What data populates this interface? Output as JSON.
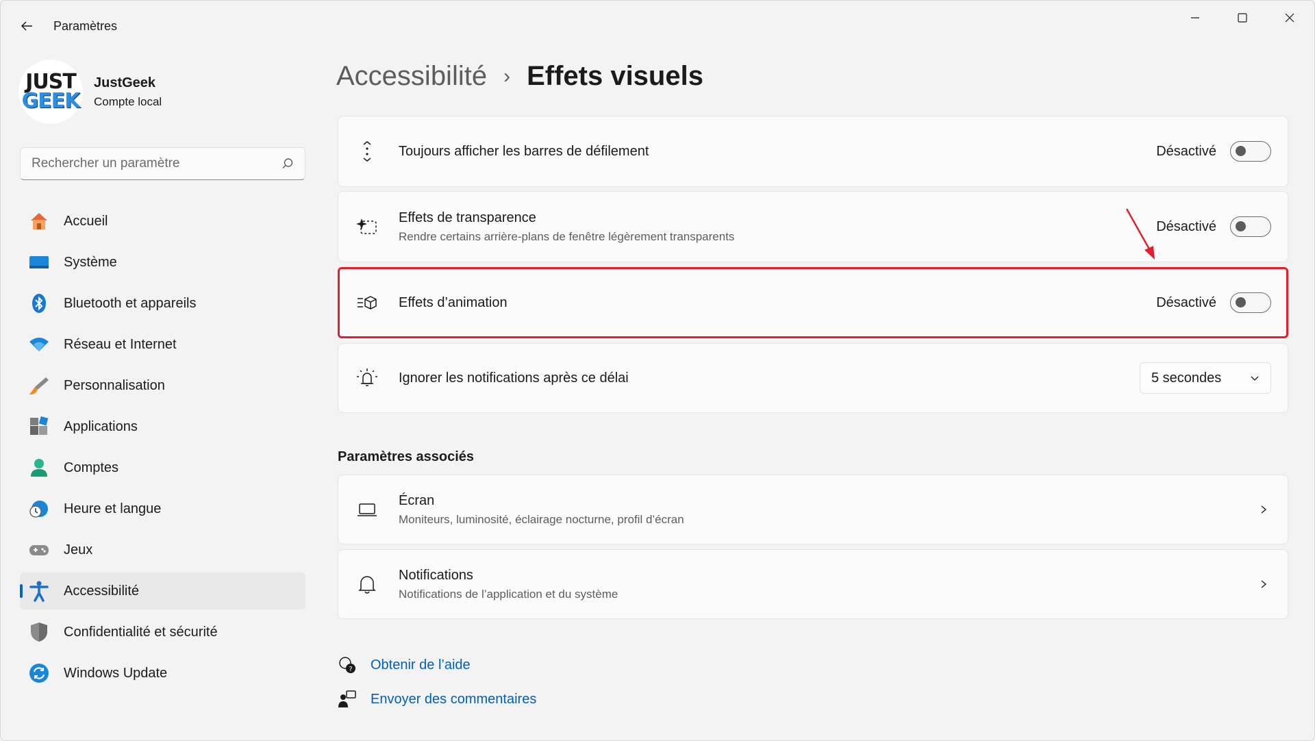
{
  "window": {
    "title": "Paramètres"
  },
  "profile": {
    "logo_line1": "JUST",
    "logo_line2": "GEEK",
    "name": "JustGeek",
    "account_type": "Compte local"
  },
  "search": {
    "placeholder": "Rechercher un paramètre"
  },
  "sidebar": {
    "items": [
      {
        "label": "Accueil",
        "icon": "home-icon"
      },
      {
        "label": "Système",
        "icon": "system-icon"
      },
      {
        "label": "Bluetooth et appareils",
        "icon": "bluetooth-icon"
      },
      {
        "label": "Réseau et Internet",
        "icon": "wifi-icon"
      },
      {
        "label": "Personnalisation",
        "icon": "brush-icon"
      },
      {
        "label": "Applications",
        "icon": "apps-icon"
      },
      {
        "label": "Comptes",
        "icon": "account-icon"
      },
      {
        "label": "Heure et langue",
        "icon": "clock-globe-icon"
      },
      {
        "label": "Jeux",
        "icon": "gamepad-icon"
      },
      {
        "label": "Accessibilité",
        "icon": "accessibility-icon",
        "active": true
      },
      {
        "label": "Confidentialité et sécurité",
        "icon": "shield-icon"
      },
      {
        "label": "Windows Update",
        "icon": "update-icon"
      }
    ]
  },
  "breadcrumb": {
    "parent": "Accessibilité",
    "separator": "›",
    "current": "Effets visuels"
  },
  "settings": [
    {
      "title": "Toujours afficher les barres de défilement",
      "state": "Désactivé",
      "on": false
    },
    {
      "title": "Effets de transparence",
      "subtitle": "Rendre certains arrière-plans de fenêtre légèrement transparents",
      "state": "Désactivé",
      "on": false
    },
    {
      "title": "Effets d’animation",
      "state": "Désactivé",
      "on": false,
      "highlighted": true
    },
    {
      "title": "Ignorer les notifications après ce délai",
      "dropdown_value": "5 secondes"
    }
  ],
  "related": {
    "heading": "Paramètres associés",
    "items": [
      {
        "title": "Écran",
        "subtitle": "Moniteurs, luminosité, éclairage nocturne, profil d’écran"
      },
      {
        "title": "Notifications",
        "subtitle": "Notifications de l’application et du système"
      }
    ]
  },
  "links": {
    "help": "Obtenir de l’aide",
    "feedback": "Envoyer des commentaires"
  },
  "colors": {
    "accent": "#0067c0",
    "link": "#005fb8",
    "highlight": "#e0202b"
  }
}
